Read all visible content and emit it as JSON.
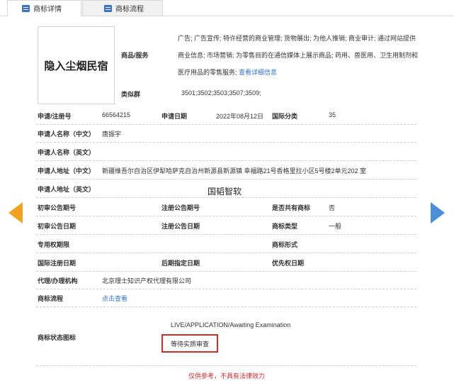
{
  "tabs": [
    {
      "label": "商标详情"
    },
    {
      "label": "商标流程"
    }
  ],
  "logo_text": "隐入尘烟民宿",
  "services": {
    "label": "商品/服务",
    "text": "广告; 广告宣传; 特许经营的商业管理; 货物展出; 为他人推销; 商业审计; 通过网站提供商业信息; 市场营销; 为零售目的在通信媒体上展示商品; 药用、兽医用、卫生用制剂和医疗用品的零售服务;",
    "more_link": "查看详细信息"
  },
  "similar_group": {
    "label": "类似群",
    "value": "3501;3502;3503;3507;3509;"
  },
  "reg_no": {
    "label": "申请/注册号",
    "value": "66564215"
  },
  "apply_date": {
    "label": "申请日期",
    "value": "2022年08月12日"
  },
  "intl_class": {
    "label": "国际分类",
    "value": "35"
  },
  "applicant_cn": {
    "label": "申请人名称（中文）",
    "value": "唐振宇"
  },
  "applicant_en": {
    "label": "申请人名称（英文）",
    "value": ""
  },
  "address_cn": {
    "label": "申请人地址（中文）",
    "value": "新疆维吾尔自治区伊犁哈萨克自治州新源县新源镇 幸福路21号香格里拉小区5号楼2单元202 室"
  },
  "address_en": {
    "label": "申请人地址（英文）",
    "value": ""
  },
  "watermark": "国韬智软",
  "prelim_pub_no": {
    "label": "初审公告期号",
    "value": ""
  },
  "reg_pub_no": {
    "label": "注册公告期号",
    "value": ""
  },
  "shared": {
    "label": "是否共有商标",
    "value": "否"
  },
  "prelim_pub_date": {
    "label": "初审公告日期",
    "value": ""
  },
  "reg_pub_date": {
    "label": "注册公告日期",
    "value": ""
  },
  "tm_type": {
    "label": "商标类型",
    "value": "一般"
  },
  "exclusive_period": {
    "label": "专用权期限",
    "value": ""
  },
  "tm_form": {
    "label": "商标形式",
    "value": ""
  },
  "intl_reg_date": {
    "label": "国际注册日期",
    "value": ""
  },
  "later_date": {
    "label": "后期指定日期",
    "value": ""
  },
  "priority_date": {
    "label": "优先权日期",
    "value": ""
  },
  "agent": {
    "label": "代理/办理机构",
    "value": "北京理士知识产权代理有限公司"
  },
  "process": {
    "label": "商标流程",
    "link": "点击查看"
  },
  "status": {
    "label": "商标状态图标",
    "en": "LIVE/APPLICATION/Awaiting Examination",
    "cn": "等待实质审查"
  },
  "disclaimer": "仅供参考，不具有法律效力",
  "colors": {
    "link": "#2f74d0",
    "status_border": "#c9302c",
    "arrow_left": "#f0a21f",
    "arrow_right": "#4a90d9",
    "disclaimer": "#d9262b"
  }
}
